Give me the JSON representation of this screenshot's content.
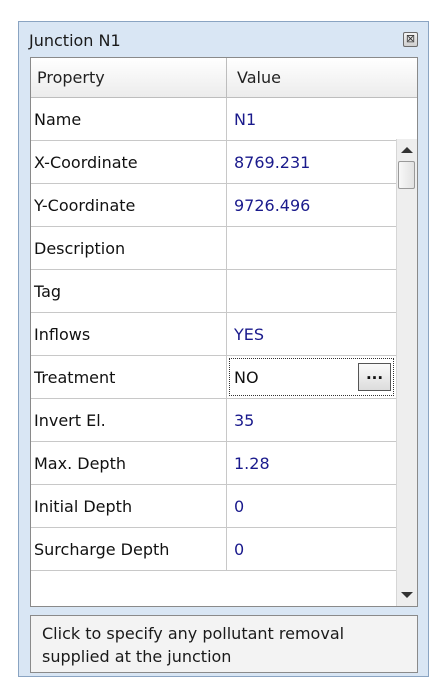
{
  "window": {
    "title": "Junction N1",
    "close_glyph": "⊠"
  },
  "grid": {
    "headers": {
      "property": "Property",
      "value": "Value"
    },
    "rows": [
      {
        "property": "Name",
        "value": "N1"
      },
      {
        "property": "X-Coordinate",
        "value": "8769.231"
      },
      {
        "property": "Y-Coordinate",
        "value": "9726.496"
      },
      {
        "property": "Description",
        "value": ""
      },
      {
        "property": "Tag",
        "value": ""
      },
      {
        "property": "Inflows",
        "value": "YES"
      },
      {
        "property": "Treatment",
        "value": "NO",
        "button_label": "..."
      },
      {
        "property": "Invert El.",
        "value": "35"
      },
      {
        "property": "Max. Depth",
        "value": "1.28"
      },
      {
        "property": "Initial Depth",
        "value": "0"
      },
      {
        "property": "Surcharge Depth",
        "value": "0"
      }
    ]
  },
  "hint": "Click to specify any pollutant removal supplied at the junction",
  "colors": {
    "value_text": "#1a1a8c",
    "frame_bg": "#d9e6f4"
  }
}
